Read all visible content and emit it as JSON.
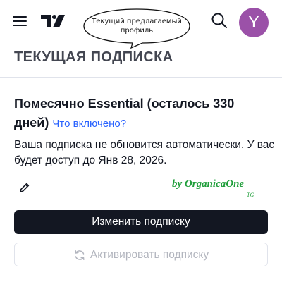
{
  "header": {
    "profile_initial": "Y",
    "annotation": "Текущий предлагаемый профиль"
  },
  "section_title": "ТЕКУЩАЯ ПОДПИСКА",
  "plan": {
    "title": "Помесячно Essential (осталось 330 дней)",
    "whats_included_link": "Что включено?"
  },
  "renewal_note": "Ваша подписка не обновится автоматически. У вас будет доступ до Янв 28, 2026.",
  "watermark": {
    "text": "by OrganicaOne",
    "sub": "TG"
  },
  "buttons": {
    "change_label": "Изменить подписку",
    "activate_label": "Активировать подписку"
  },
  "colors": {
    "avatar": "#9b51a8",
    "link": "#2962ff",
    "primary_button": "#131722",
    "watermark": "#1f9e3a"
  },
  "icons": {
    "menu": "hamburger-menu-icon",
    "logo": "tradingview-logo",
    "search": "search-icon",
    "edit": "pencil-icon",
    "refresh": "refresh-icon"
  }
}
